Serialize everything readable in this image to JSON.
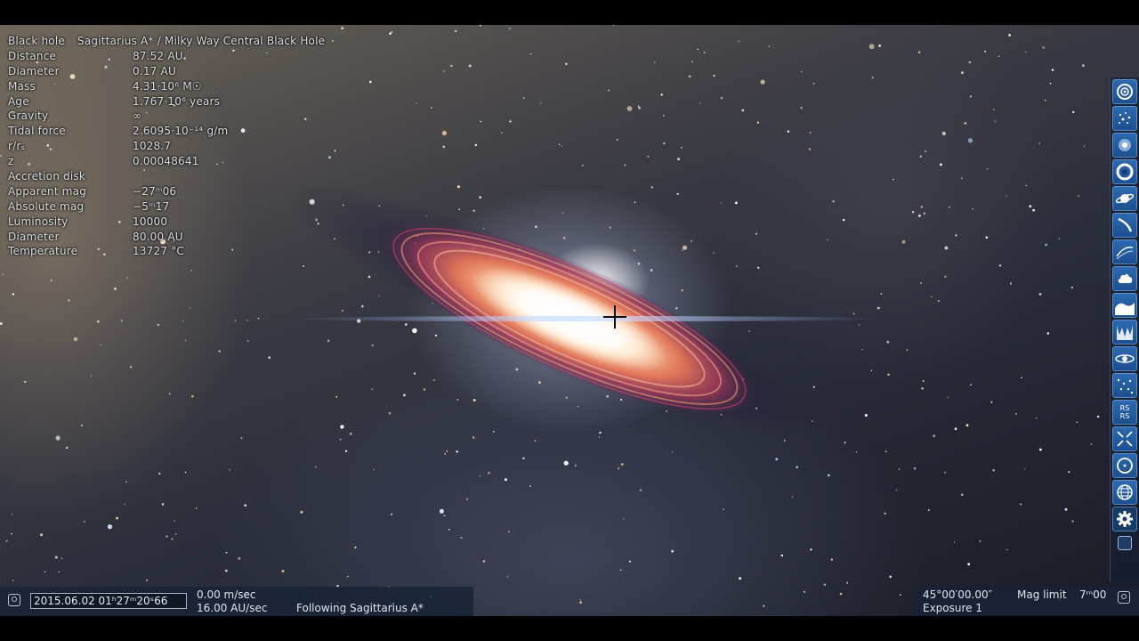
{
  "object_info": {
    "type_label": "Black hole",
    "name": "Sagittarius A* / Milky Way Central Black Hole",
    "rows": [
      {
        "label": "Distance",
        "value": "87.52 AU"
      },
      {
        "label": "Diameter",
        "value": "0.17 AU"
      },
      {
        "label": "Mass",
        "value": "4.31·10⁶ M☉"
      },
      {
        "label": "Age",
        "value": "1.767·10⁶ years"
      },
      {
        "label": "Gravity",
        "value": "∞"
      },
      {
        "label": "Tidal force",
        "value": "2.6095·10⁻¹⁴ g/m"
      },
      {
        "label": "r/rₛ",
        "value": "1028.7"
      },
      {
        "label": "z",
        "value": "0.00048641"
      },
      {
        "label": "Accretion disk",
        "value": ""
      },
      {
        "label": "Apparent mag",
        "value": "−27ᵐ06"
      },
      {
        "label": "Absolute mag",
        "value": "−5ᵐ17"
      },
      {
        "label": "Luminosity",
        "value": "10000"
      },
      {
        "label": "Diameter",
        "value": "80.00 AU"
      },
      {
        "label": "Temperature",
        "value": "13727 °C"
      }
    ]
  },
  "toolbar": {
    "icons": [
      "galaxy-filter-icon",
      "star-cluster-filter-icon",
      "nebula-filter-icon",
      "black-hole-filter-icon",
      "planet-filter-icon",
      "comet-filter-icon",
      "orbit-filter-icon",
      "cloud-filter-icon",
      "wave-filter-icon",
      "aurora-filter-icon",
      "accretion-disk-filter-icon",
      "stars-filter-icon",
      "rs-label-icon",
      "collapse-icon",
      "orbit-circle-icon",
      "globe-grid-icon",
      "settings-gear-icon"
    ],
    "rs_label": "RS"
  },
  "status_bar": {
    "date_time": "2015.06.02  01ʰ27ᵐ20ˢ66",
    "speed": "0.00  m/sec",
    "time_rate": "16.00  AU/sec",
    "mode": "Following Sagittarius A*",
    "fov": "45°00′00.00″",
    "mag_limit_label": "Mag limit",
    "mag_limit_value": "7ᵐ00",
    "exposure": "Exposure 1"
  }
}
